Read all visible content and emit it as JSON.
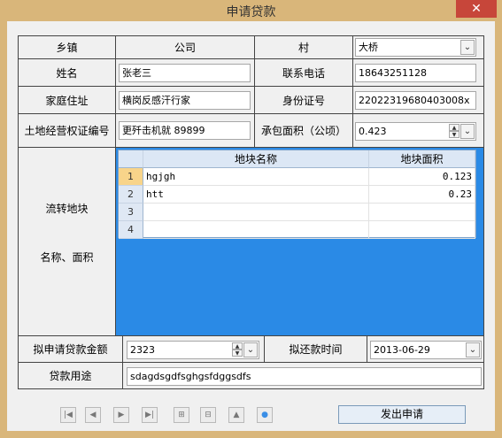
{
  "window": {
    "title": "申请贷款",
    "close_glyph": "✕"
  },
  "form": {
    "township_label": "乡镇",
    "township_value": "公司",
    "village_label": "村",
    "village_value": "大桥",
    "name_label": "姓名",
    "name_value": "张老三",
    "phone_label": "联系电话",
    "phone_value": "18643251128",
    "address_label": "家庭住址",
    "address_value": "横岗反感汗行家",
    "id_label": "身份证号",
    "id_value": "22022319680403008x",
    "land_cert_label": "土地经营权证编号",
    "land_cert_value": "更歼击机就 89899",
    "area_label": "承包面积（公顷）",
    "area_value": "0.423",
    "transfer_label_1": "流转地块",
    "transfer_label_2": "名称、面积",
    "amount_label": "拟申请贷款金额",
    "amount_value": "2323",
    "repay_label": "拟还款时间",
    "repay_value": "2013-06-29",
    "purpose_label": "贷款用途",
    "purpose_value": "sdagdsgdfsghgsfdggsdfs"
  },
  "grid": {
    "columns": [
      "地块名称",
      "地块面积"
    ],
    "rows": [
      {
        "num": "1",
        "name": "hgjgh",
        "area": "0.123"
      },
      {
        "num": "2",
        "name": "htt",
        "area": "0.23"
      },
      {
        "num": "3",
        "name": "",
        "area": ""
      },
      {
        "num": "4",
        "name": "",
        "area": ""
      }
    ]
  },
  "nav": {
    "icons": [
      "first-icon",
      "prev-icon",
      "next-icon",
      "last-icon",
      "add-icon",
      "delete-icon",
      "up-icon",
      "record-icon"
    ],
    "glyphs": [
      "|◀",
      "◀",
      "▶",
      "▶|",
      "⊞",
      "⊟",
      "▲",
      "●"
    ]
  },
  "submit_label": "发出申请",
  "colors": {
    "title_bg": "#d9b67a",
    "grid_bg": "#2a8ae6",
    "close_bg": "#c7463a"
  }
}
